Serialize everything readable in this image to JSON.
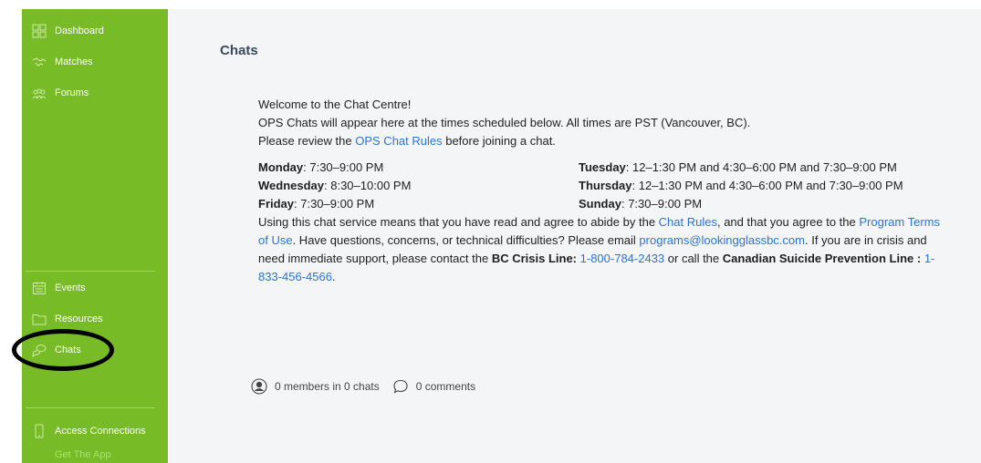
{
  "sidebar": {
    "items_top": [
      {
        "label": "Dashboard",
        "icon": "dashboard-grid-icon"
      },
      {
        "label": "Matches",
        "icon": "handshake-icon"
      },
      {
        "label": "Forums",
        "icon": "people-group-icon"
      }
    ],
    "items_bottom": [
      {
        "label": "Events",
        "icon": "calendar-icon"
      },
      {
        "label": "Resources",
        "icon": "folder-icon"
      },
      {
        "label": "Chats",
        "icon": "chat-bubbles-icon"
      }
    ],
    "access": {
      "label": "Access Connections",
      "icon": "mobile-phone-icon",
      "app_link": "Get The App"
    }
  },
  "colors": {
    "sidebar_bg": "#77bb27",
    "link": "#2a74d4",
    "title": "#3b4a5c",
    "annotation_circle": "#000000"
  },
  "main": {
    "title": "Chats",
    "intro": {
      "line1": "Welcome to the Chat Centre!",
      "line2": "OPS Chats will appear here at the times scheduled below. All times are PST (Vancouver, BC).",
      "line3_pre": "Please review the ",
      "line3_link": "OPS Chat Rules",
      "line3_post": " before joining a chat."
    },
    "schedule": [
      {
        "day": "Monday",
        "times": ": 7:30–9:00 PM"
      },
      {
        "day": "Tuesday",
        "times": ": 12–1:30 PM and 4:30–6:00 PM and 7:30–9:00 PM"
      },
      {
        "day": "Wednesday",
        "times": ": 8:30–10:00 PM"
      },
      {
        "day": "Thursday",
        "times": ": 12–1:30 PM and 4:30–6:00 PM and 7:30–9:00 PM"
      },
      {
        "day": "Friday",
        "times": ": 7:30–9:00 PM"
      },
      {
        "day": "Sunday",
        "times": ": 7:30–9:00 PM"
      }
    ],
    "terms": {
      "t1": "Using this chat service means that you have read and agree to abide by the ",
      "l1": "Chat Rules",
      "t2": ", and that you agree to the ",
      "l2": "Program Terms of Use",
      "t3": ". Have questions, concerns, or technical difficulties? Please email ",
      "l3": "programs@lookingglassbc.com",
      "t4": ". If you are in crisis and need immediate support, please contact the ",
      "b1": "BC Crisis Line:",
      "t5": " ",
      "l4": "1-800-784-2433",
      "t6": " or call the ",
      "b2": "Canadian Suicide Prevention Line :",
      "t7": " ",
      "l5": "1-833-456-4566",
      "t8": "."
    },
    "footer": {
      "members": "0 members in 0 chats",
      "comments": "0 comments"
    }
  }
}
